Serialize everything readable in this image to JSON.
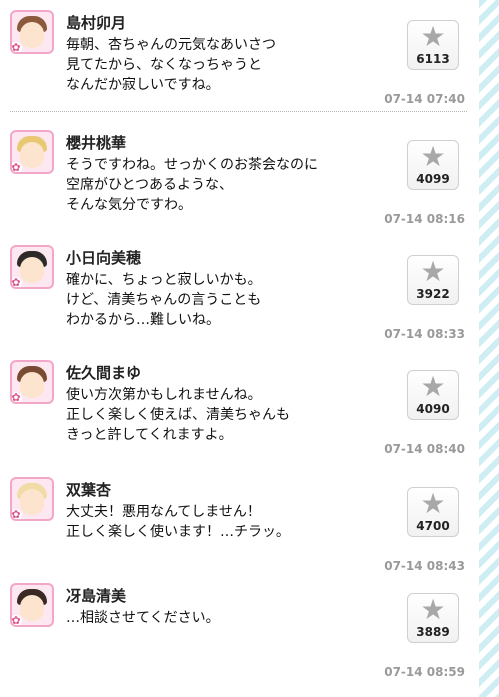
{
  "posts": [
    {
      "name": "島村卯月",
      "lines": [
        "毎朝、杏ちゃんの元気なあいさつ",
        "見てたから、なくなっちゃうと",
        "なんだか寂しいですね。"
      ],
      "likes": "6113",
      "time": "07-14 07:40",
      "hair_color": "#8b5a3c"
    },
    {
      "name": "櫻井桃華",
      "lines": [
        "そうですわね。せっかくのお茶会なのに",
        "空席がひとつあるような、",
        "そんな気分ですわ。"
      ],
      "likes": "4099",
      "time": "07-14 08:16",
      "hair_color": "#e8c872"
    },
    {
      "name": "小日向美穂",
      "lines": [
        "確かに、ちょっと寂しいかも。",
        "けど、清美ちゃんの言うことも",
        "わかるから…難しいね。"
      ],
      "likes": "3922",
      "time": "07-14 08:33",
      "hair_color": "#2e2a2a"
    },
    {
      "name": "佐久間まゆ",
      "lines": [
        "使い方次第かもしれませんね。",
        "正しく楽しく使えば、清美ちゃんも",
        "きっと許してくれますよ。"
      ],
      "likes": "4090",
      "time": "07-14 08:40",
      "hair_color": "#7a4a32"
    },
    {
      "name": "双葉杏",
      "lines": [
        "大丈夫！悪用なんてしません！",
        "正しく楽しく使います！…チラッ。"
      ],
      "likes": "4700",
      "time": "07-14 08:43",
      "hair_color": "#f1dca8"
    },
    {
      "name": "冴島清美",
      "lines": [
        "…相談させてください。"
      ],
      "likes": "3889",
      "time": "07-14 08:59",
      "hair_color": "#3a2a24"
    }
  ],
  "icons": {
    "like": "star-icon",
    "badge": "flower-icon"
  }
}
